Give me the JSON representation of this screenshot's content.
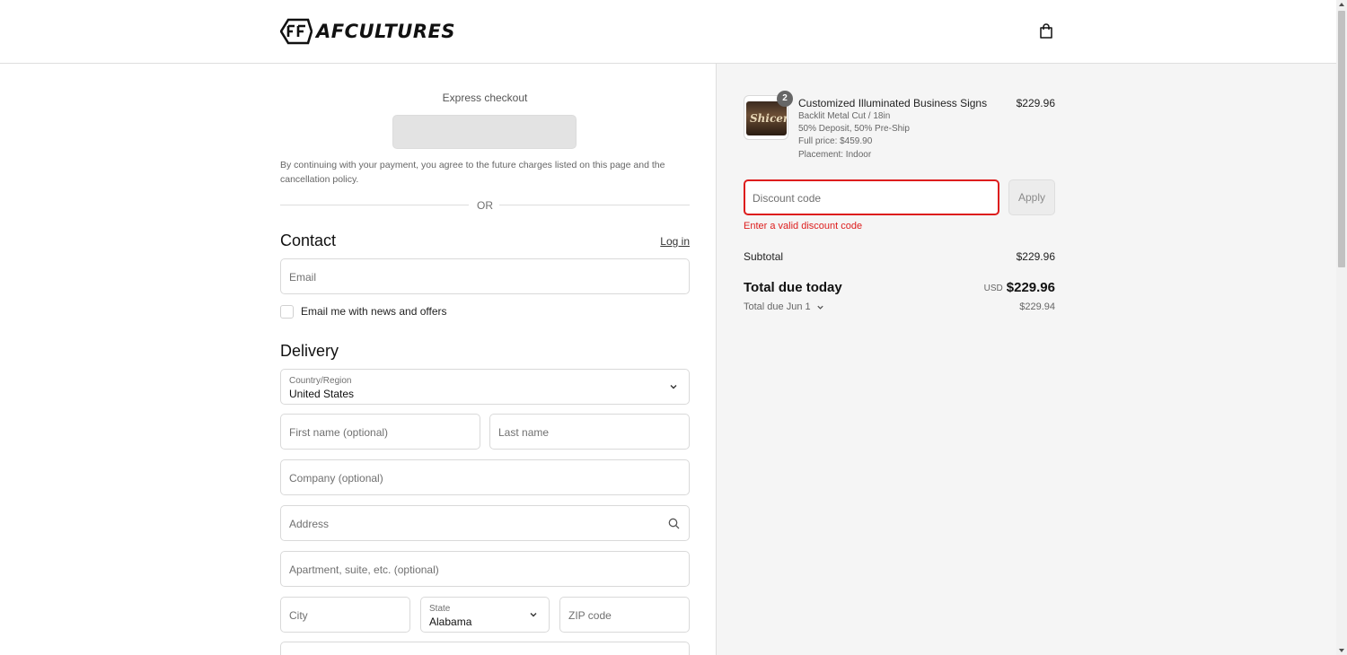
{
  "header": {
    "brand": "AFCULTURES"
  },
  "express": {
    "title": "Express checkout",
    "consent": "By continuing with your payment, you agree to the future charges listed on this page and the cancellation policy.",
    "or_label": "OR"
  },
  "contact": {
    "heading": "Contact",
    "login_label": "Log in",
    "email_placeholder": "Email",
    "newsletter_label": "Email me with news and offers",
    "newsletter_checked": false
  },
  "delivery": {
    "heading": "Delivery",
    "country_label": "Country/Region",
    "country_value": "United States",
    "first_name_placeholder": "First name (optional)",
    "last_name_placeholder": "Last name",
    "company_placeholder": "Company (optional)",
    "address_placeholder": "Address",
    "apartment_placeholder": "Apartment, suite, etc. (optional)",
    "city_placeholder": "City",
    "state_label": "State",
    "state_value": "Alabama",
    "zip_placeholder": "ZIP code"
  },
  "order": {
    "quantity": "2",
    "thumb_text": "Shicers",
    "item_title": "Customized Illuminated Business Signs",
    "item_price": "$229.96",
    "item_details": [
      "Backlit Metal Cut / 18in",
      "50% Deposit, 50% Pre-Ship",
      "Full price: $459.90",
      "Placement: Indoor"
    ],
    "discount_placeholder": "Discount code",
    "apply_label": "Apply",
    "discount_error": "Enter a valid discount code",
    "subtotal_label": "Subtotal",
    "subtotal_value": "$229.96",
    "total_label": "Total due today",
    "total_currency": "USD",
    "total_value": "$229.96",
    "due_later_label": "Total due Jun 1",
    "due_later_value": "$229.94"
  },
  "colors": {
    "error": "#dd1d1d",
    "right_panel_bg": "#f5f5f5"
  }
}
